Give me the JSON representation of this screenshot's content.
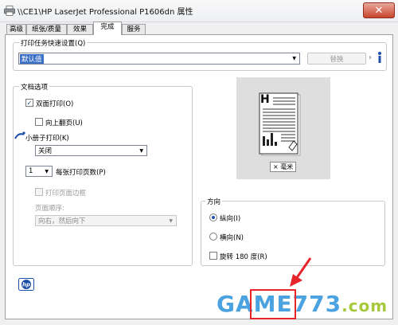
{
  "window": {
    "title": "\\\\CE1\\HP LaserJet Professional P1606dn 属性",
    "close_glyph": "✕"
  },
  "tabs": [
    {
      "label": "高级"
    },
    {
      "label": "纸张/质量"
    },
    {
      "label": "效果"
    },
    {
      "label": "完成"
    },
    {
      "label": "服务"
    }
  ],
  "shortcuts": {
    "label": "打印任务快速设置(Q)",
    "value": "默认值",
    "replace_button": "替换"
  },
  "document_options": {
    "label": "文档选项",
    "duplex_label": "双面打印(O)",
    "flip_up_label": "向上翻页(U)",
    "booklet_label": "小册子打印(K)",
    "booklet_value": "关闭",
    "pages_per_sheet_value": "1",
    "pages_per_sheet_label": "每张打印页数(P)",
    "print_borders_label": "打印页面边框",
    "page_order_label": "页面顺序:",
    "page_order_value": "向右，然后向下"
  },
  "preview": {
    "unit_badge": "× 毫米",
    "heading_glyph": "H"
  },
  "orientation": {
    "label": "方向",
    "portrait_label": "纵向(I)",
    "landscape_label": "横向(N)",
    "rotate_label": "旋转 180 度(R)"
  },
  "watermark": {
    "text": "GAME773",
    "suffix": ".com"
  },
  "colors": {
    "accent": "#1d4fa8",
    "close": "#c7442d",
    "highlight": "#e6242a"
  }
}
